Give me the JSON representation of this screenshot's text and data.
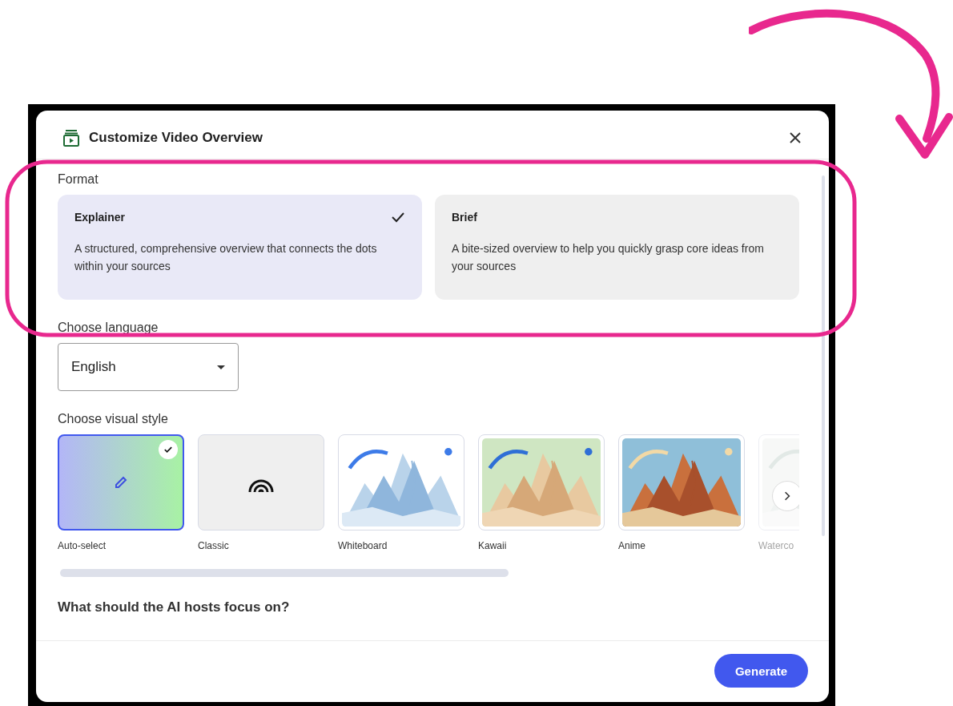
{
  "dialog": {
    "title": "Customize Video Overview"
  },
  "format": {
    "label": "Format",
    "options": [
      {
        "title": "Explainer",
        "description": "A structured, comprehensive overview that connects the dots within your sources",
        "selected": true
      },
      {
        "title": "Brief",
        "description": "A bite-sized overview to help you quickly grasp core ideas from your sources",
        "selected": false
      }
    ]
  },
  "language": {
    "label": "Choose language",
    "value": "English"
  },
  "visual_style": {
    "label": "Choose visual style",
    "styles": [
      {
        "name": "Auto-select",
        "kind": "auto",
        "selected": true
      },
      {
        "name": "Classic",
        "kind": "classic",
        "selected": false
      },
      {
        "name": "Whiteboard",
        "kind": "picture",
        "selected": false
      },
      {
        "name": "Kawaii",
        "kind": "picture",
        "selected": false
      },
      {
        "name": "Anime",
        "kind": "picture",
        "selected": false
      },
      {
        "name": "Waterco",
        "kind": "picture",
        "selected": false
      }
    ]
  },
  "focus": {
    "label": "What should the AI hosts focus on?"
  },
  "buttons": [
    {
      "label": "Generate"
    }
  ]
}
